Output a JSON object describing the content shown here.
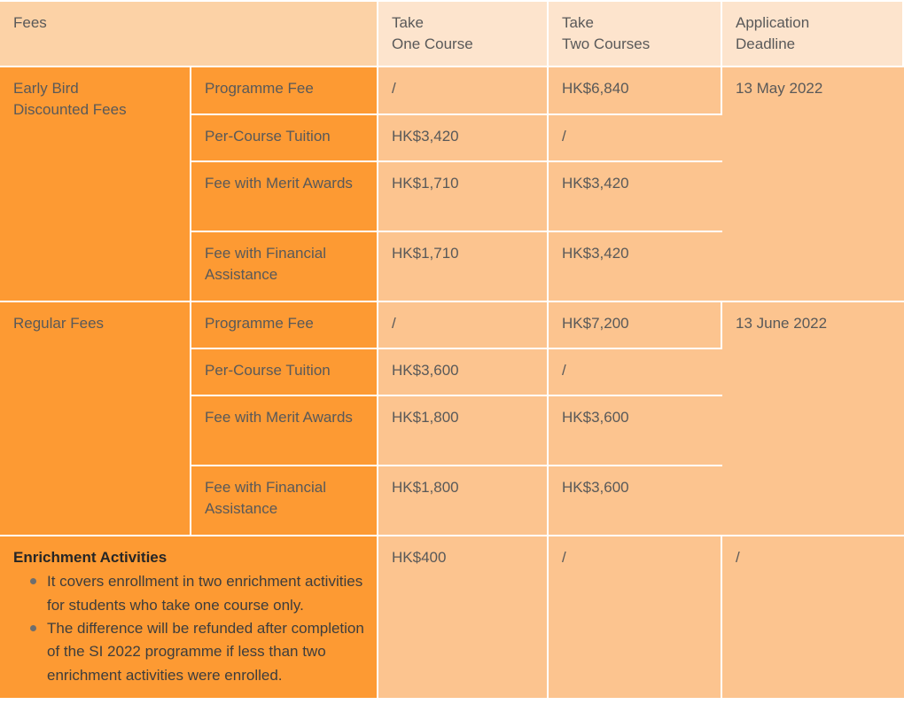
{
  "table": {
    "columns": [
      {
        "key": "fees",
        "label": "Fees"
      },
      {
        "key": "take_one",
        "label_line1": "Take",
        "label_line2": "One Course"
      },
      {
        "key": "take_two",
        "label_line1": "Take",
        "label_line2": "Two Courses"
      },
      {
        "key": "deadline",
        "label_line1": "Application",
        "label_line2": "Deadline"
      }
    ],
    "groups": [
      {
        "title_line1": "Early Bird",
        "title_line2": "Discounted Fees",
        "deadline": "13 May 2022",
        "rows": [
          {
            "label_line1": "Programme Fee",
            "label_line2": "",
            "take_one": "/",
            "take_two": "HK$6,840"
          },
          {
            "label_line1": "Per-Course Tuition",
            "label_line2": "",
            "take_one": "HK$3,420",
            "take_two": "/"
          },
          {
            "label_line1": "Fee with Merit",
            "label_line2": "Awards",
            "take_one": "HK$1,710",
            "take_two": "HK$3,420"
          },
          {
            "label_line1": "Fee with Financial",
            "label_line2": "Assistance",
            "take_one": "HK$1,710",
            "take_two": "HK$3,420"
          }
        ]
      },
      {
        "title_line1": "Regular Fees",
        "title_line2": "",
        "deadline": "13 June 2022",
        "rows": [
          {
            "label_line1": "Programme Fee",
            "label_line2": "",
            "take_one": "/",
            "take_two": "HK$7,200"
          },
          {
            "label_line1": "Per-Course Tuition",
            "label_line2": "",
            "take_one": "HK$3,600",
            "take_two": "/"
          },
          {
            "label_line1": "Fee with Merit",
            "label_line2": "Awards",
            "take_one": "HK$1,800",
            "take_two": "HK$3,600"
          },
          {
            "label_line1": "Fee with Financial",
            "label_line2": "Assistance",
            "take_one": "HK$1,800",
            "take_two": "HK$3,600"
          }
        ]
      }
    ],
    "enrichment": {
      "title": "Enrichment Activities",
      "bullets": [
        "It covers enrollment in two enrichment activities for students who take one course only.",
        "The difference will be refunded after completion of the SI 2022 programme if less than two enrichment activities were enrolled."
      ],
      "take_one": "HK$400",
      "take_two": "/",
      "deadline": "/"
    }
  },
  "colors": {
    "header_left_bg": "#fcd2a6",
    "header_right_bg": "#fde4cd",
    "label_bg": "#fd9a33",
    "value_bg": "#fcc48f",
    "grid": "#ffffff",
    "value_text": "#6b6b6b",
    "label_text": "#262626",
    "bullet": "#6e6e6e"
  }
}
